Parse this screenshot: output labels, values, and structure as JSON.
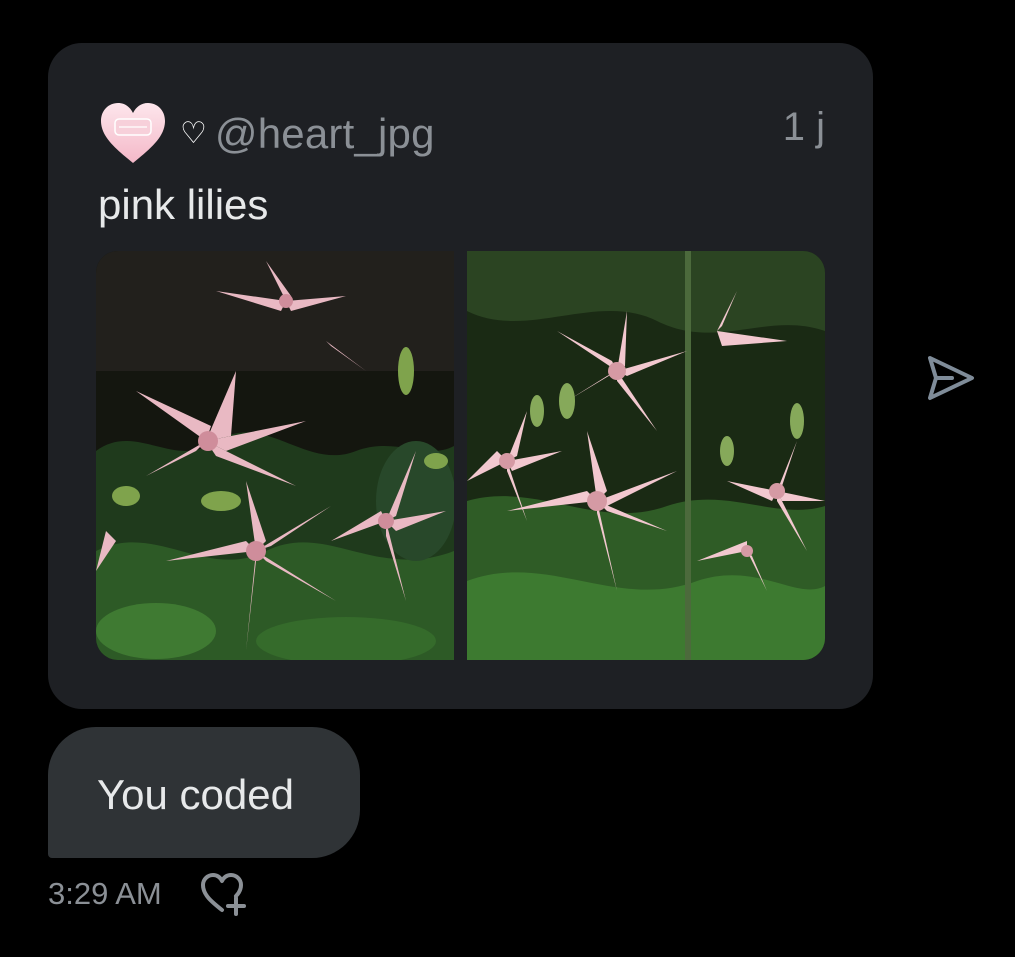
{
  "quote": {
    "handle": "@heart_jpg",
    "heart_symbol": "♡",
    "time_ago": "1 j",
    "text": "pink lilies",
    "avatar_icon": "pink-heart-avatar",
    "media": [
      {
        "icon": "pink-lilies-photo-left"
      },
      {
        "icon": "pink-lilies-photo-right"
      }
    ]
  },
  "message": {
    "text": "You coded",
    "timestamp": "3:29 AM"
  },
  "icons": {
    "share": "send-icon",
    "react": "add-reaction-icon"
  },
  "colors": {
    "background": "#000000",
    "card": "#1e2024",
    "bubble": "#2f3336",
    "muted_text": "#8b9096",
    "primary_text": "#e7e9ea"
  }
}
